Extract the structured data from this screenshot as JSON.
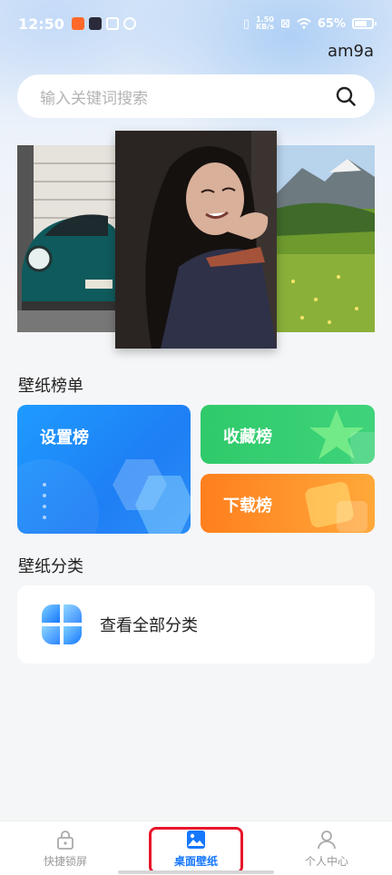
{
  "status_bar": {
    "time": "12:50",
    "net_speed_value": "1.50",
    "net_speed_unit": "KB/s",
    "battery": "65%"
  },
  "header": {
    "username": "am9a"
  },
  "search": {
    "placeholder": "输入关键词搜索"
  },
  "sections": {
    "rankings_title": "壁纸榜单",
    "categories_title": "壁纸分类"
  },
  "rankings": {
    "setting": "设置榜",
    "favorite": "收藏榜",
    "download": "下载榜"
  },
  "categories": {
    "view_all": "查看全部分类"
  },
  "tabbar": {
    "items": [
      {
        "label": "快捷锁屏"
      },
      {
        "label": "桌面壁纸"
      },
      {
        "label": "个人中心"
      }
    ],
    "active_index": 1
  },
  "colors": {
    "accent": "#1677ff",
    "setting_card": "#1e8cff",
    "favorite_card": "#35cd70",
    "download_card": "#ff8c28",
    "highlight_box": "#e8162b"
  }
}
